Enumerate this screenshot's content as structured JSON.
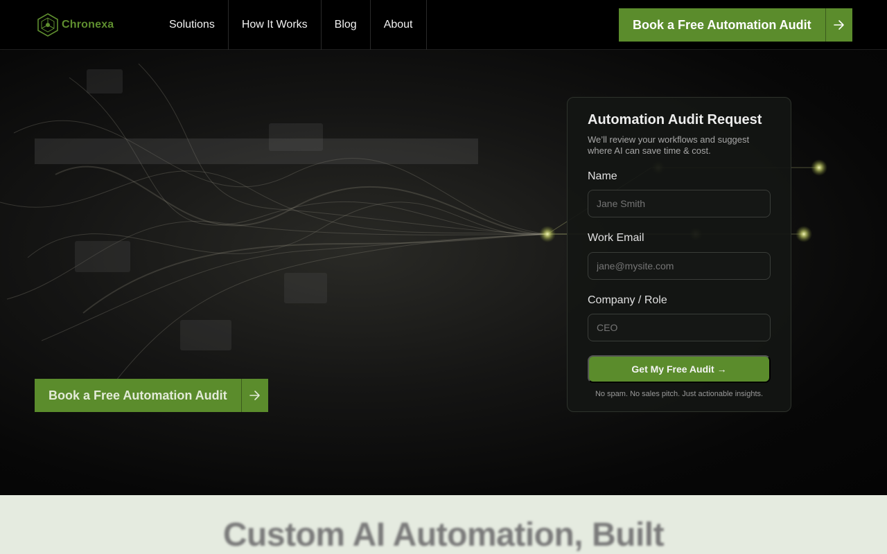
{
  "brand": {
    "name": "Chronexa",
    "accent": "#5b8c2c"
  },
  "nav": {
    "items": [
      {
        "label": "Solutions"
      },
      {
        "label": "How It Works"
      },
      {
        "label": "Blog"
      },
      {
        "label": "About"
      }
    ]
  },
  "header": {
    "cta_label": "Book a Free Automation Audit",
    "cta_icon": "arrow-right-icon"
  },
  "hero": {
    "cta_label": "Book a Free Automation Audit",
    "cta_icon": "arrow-right-icon"
  },
  "form": {
    "title": "Automation Audit Request",
    "subtitle": "We’ll review your workflows and suggest where AI can save time & cost.",
    "fields": [
      {
        "label": "Name",
        "placeholder": "Jane Smith",
        "value": ""
      },
      {
        "label": "Work Email",
        "placeholder": "jane@mysite.com",
        "value": ""
      },
      {
        "label": "Company /  Role",
        "placeholder": "CEO",
        "value": ""
      }
    ],
    "submit_label": "Get My Free Audit →",
    "disclaimer": "No spam. No sales pitch. Just actionable insights."
  },
  "section2": {
    "title": "Custom AI Automation, Built"
  }
}
